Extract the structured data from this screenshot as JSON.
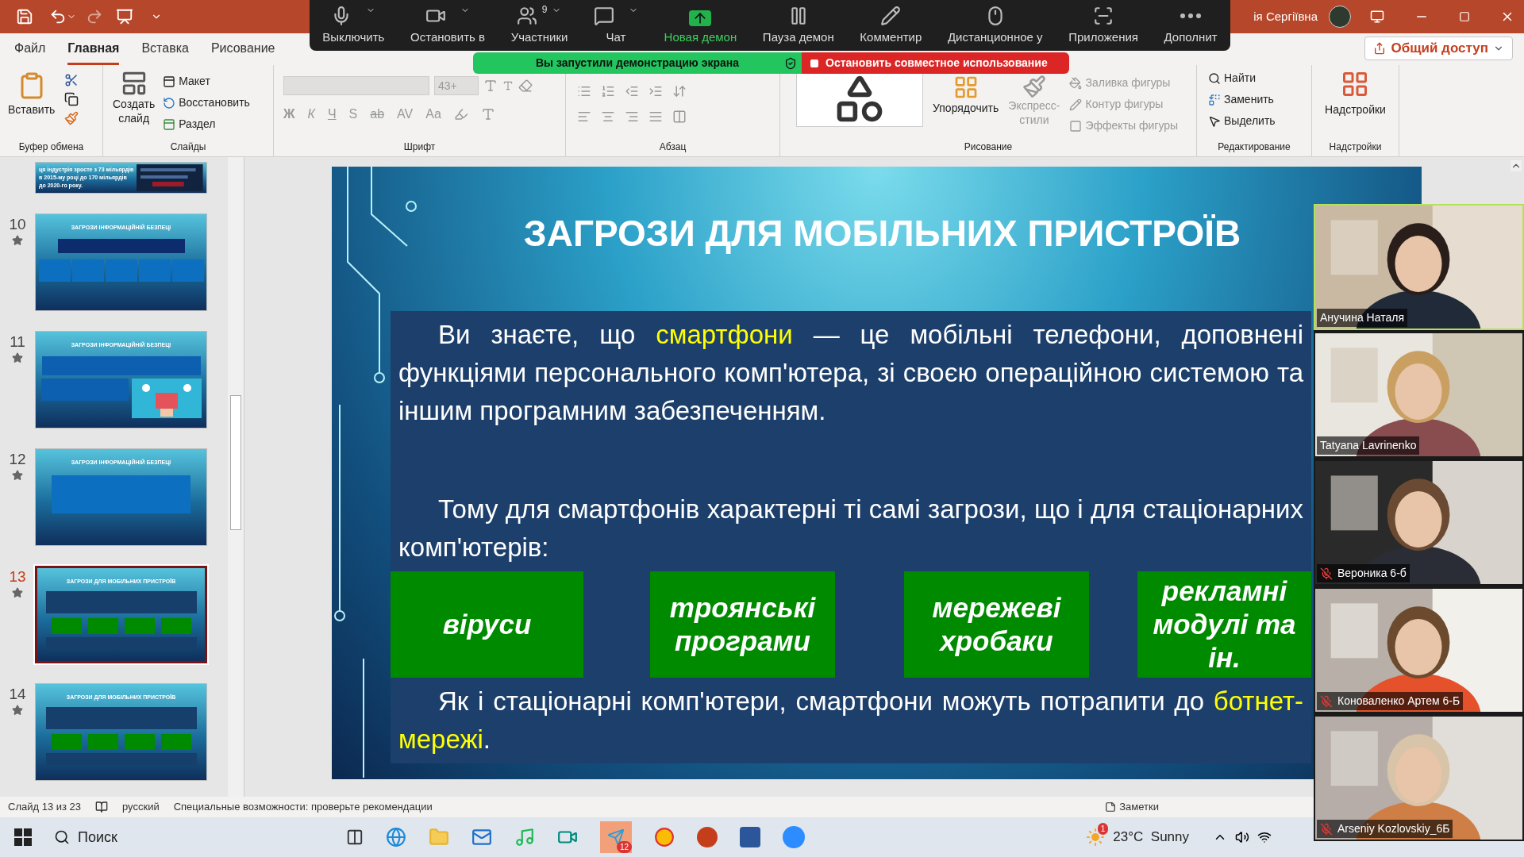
{
  "title_bar": {
    "user_name": "ія Сергіївна"
  },
  "zoom_toolbar": {
    "items": [
      {
        "label": "Выключить",
        "kind": "mic",
        "caret": true
      },
      {
        "label": "Остановить в",
        "kind": "video",
        "caret": true
      },
      {
        "label": "Участники",
        "kind": "participants",
        "caret": true,
        "count": "9"
      },
      {
        "label": "Чат",
        "kind": "chat",
        "caret": true
      },
      {
        "label": "Новая демон",
        "kind": "share",
        "caret": false
      },
      {
        "label": "Пауза демон",
        "kind": "pause",
        "caret": false
      },
      {
        "label": "Комментир",
        "kind": "annotate",
        "caret": false
      },
      {
        "label": "Дистанционное у",
        "kind": "remote",
        "caret": false
      },
      {
        "label": "Приложения",
        "kind": "apps",
        "caret": false
      },
      {
        "label": "Дополнит",
        "kind": "more",
        "caret": false
      }
    ]
  },
  "share_banner": {
    "status": "Вы запустили демонстрацию экрана",
    "stop": "Остановить совместное использование"
  },
  "ribbon_tabs": [
    {
      "label": "Файл",
      "selected": false
    },
    {
      "label": "Главная",
      "selected": true
    },
    {
      "label": "Вставка",
      "selected": false
    },
    {
      "label": "Рисование",
      "selected": false
    }
  ],
  "share_button": "Общий доступ",
  "ribbon": {
    "clipboard": {
      "paste": "Вставить",
      "label": "Буфер обмена"
    },
    "slides": {
      "new_slide_1": "Создать",
      "new_slide_2": "слайд",
      "layout": "Макет",
      "reset": "Восстановить",
      "section": "Раздел",
      "label": "Слайды"
    },
    "font": {
      "size": "43+",
      "bold": "Ж",
      "italic": "К",
      "underline": "Ч",
      "shadow": "S",
      "strike": "ab",
      "spacing": "AV",
      "case": "Aa",
      "label": "Шрифт"
    },
    "paragraph": {
      "label": "Абзац"
    },
    "drawing": {
      "arrange": "Упорядочить",
      "styles_1": "Экспресс-",
      "styles_2": "стили",
      "fill": "Заливка фигуры",
      "outline": "Контур фигуры",
      "effects": "Эффекты фигуры",
      "label": "Рисование"
    },
    "editing": {
      "find": "Найти",
      "replace": "Заменить",
      "select": "Выделить",
      "label": "Редактирование"
    },
    "addins": {
      "button": "Надстройки",
      "label": "Надстройки"
    }
  },
  "thumbnails": [
    {
      "kind": "partial",
      "title": "ця індустрія зросте з 73 мільярдів в 2015-му році до 170 мільярдів до 2020-го року.",
      "selected": false
    },
    {
      "number": "10",
      "kind": "boxes",
      "title": "ЗАГРОЗИ ІНФОРМАЦІЙНІЙ БЕЗПЕЦІ",
      "selected": false
    },
    {
      "number": "11",
      "title": "ЗАГРОЗИ ІНФОРМАЦІЙНІЙ БЕЗПЕЦІ",
      "selected": false
    },
    {
      "number": "12",
      "kind": "text",
      "title": "ЗАГРОЗИ ІНФОРМАЦІЙНІЙ БЕЗПЕЦІ",
      "selected": false
    },
    {
      "number": "13",
      "kind": "green",
      "title": "ЗАГРОЗИ ДЛЯ МОБІЛЬНИХ ПРИСТРОЇВ",
      "selected": true
    },
    {
      "number": "14",
      "kind": "green",
      "title": "ЗАГРОЗИ ДЛЯ МОБІЛЬНИХ ПРИСТРОЇВ",
      "selected": false
    }
  ],
  "slide": {
    "title": "ЗАГРОЗИ ДЛЯ МОБІЛЬНИХ ПРИСТРОЇВ",
    "paragraph_1": [
      {
        "text": "Ви знаєте, що ",
        "highlight": false
      },
      {
        "text": "смартфони",
        "highlight": true
      },
      {
        "text": " — це мобільні телефони, доповнені функціями персонального комп'ютера, зі своєю операційною системою та іншим програмним забезпеченням.",
        "highlight": false
      }
    ],
    "paragraph_2": [
      {
        "text": "Тому для смартфонів характерні ті самі загрози, що і для стаціонарних комп'ютерів:",
        "highlight": false
      }
    ],
    "threats": [
      "віруси",
      "троянські програми",
      "мережеві хробаки",
      "рекламні модулі та ін."
    ],
    "paragraph_3": [
      {
        "text": "Як і стаціонарні комп'ютери, смартфони можуть потрапити до ",
        "highlight": false
      },
      {
        "text": "ботнет-мережі",
        "highlight": true
      },
      {
        "text": ".",
        "highlight": false
      }
    ]
  },
  "participants": [
    {
      "name": "Анучина Наталя",
      "muted": false,
      "speaking": true
    },
    {
      "name": "Tatyana Lavrinenko",
      "muted": false,
      "speaking": false
    },
    {
      "name": "Вероника 6-б",
      "muted": true,
      "speaking": false
    },
    {
      "name": "Коноваленко Артем 6-Б",
      "muted": true,
      "speaking": false
    },
    {
      "name": "Arseniy Kozlovskiy_6Б",
      "muted": true,
      "speaking": false
    }
  ],
  "status_bar": {
    "slide": "Слайд 13 из 23",
    "language": "русский",
    "accessibility": "Специальные возможности: проверьте рекомендации",
    "notes": "Заметки"
  },
  "taskbar": {
    "search": "Поиск",
    "weather_badge": "1",
    "telegram_badge": "12",
    "weather": "23°C  Sunny"
  }
}
